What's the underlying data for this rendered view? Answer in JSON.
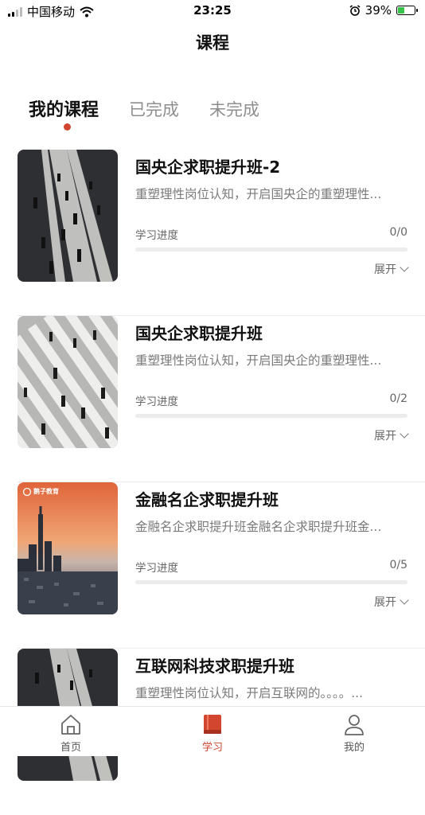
{
  "status_bar": {
    "carrier": "中国移动",
    "time": "23:25",
    "battery_percent": "39%"
  },
  "header": {
    "title": "课程"
  },
  "tabs": [
    {
      "label": "我的课程",
      "active": true
    },
    {
      "label": "已完成",
      "active": false
    },
    {
      "label": "未完成",
      "active": false
    }
  ],
  "courses": [
    {
      "title": "国央企求职提升班-2",
      "description": "重塑理性岗位认知，开启国央企的重塑理性...",
      "progress_label": "学习进度",
      "progress_value": "0/0",
      "progress_fraction": 0,
      "expand_label": "展开",
      "thumb": "street-crowd"
    },
    {
      "title": "国央企求职提升班",
      "description": "重塑理性岗位认知，开启国央企的重塑理性...",
      "progress_label": "学习进度",
      "progress_value": "0/2",
      "progress_fraction": 0,
      "expand_label": "展开",
      "thumb": "crosswalk"
    },
    {
      "title": "金融名企求职提升班",
      "description": "金融名企求职提升班金融名企求职提升班金...",
      "progress_label": "学习进度",
      "progress_value": "0/5",
      "progress_fraction": 0,
      "expand_label": "展开",
      "thumb": "city-skyline",
      "thumb_logo_text": "鹅子教育"
    },
    {
      "title": "互联网科技求职提升班",
      "description": "重塑理性岗位认知，开启互联网的。。。。...",
      "thumb": "street-crowd"
    }
  ],
  "bottom_nav": [
    {
      "label": "首页",
      "icon": "home-icon",
      "active": false
    },
    {
      "label": "学习",
      "icon": "book-icon",
      "active": true
    },
    {
      "label": "我的",
      "icon": "user-icon",
      "active": false
    }
  ],
  "colors": {
    "accent": "#d2452e",
    "text": "#111111",
    "muted": "#7a7a7a"
  }
}
